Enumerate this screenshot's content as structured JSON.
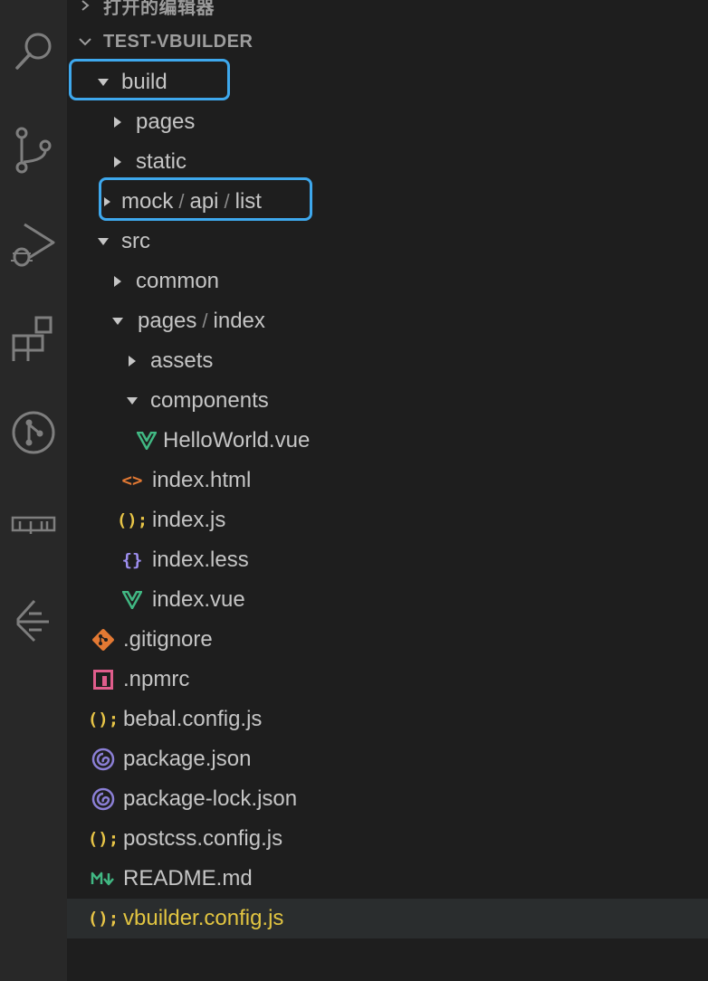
{
  "explorer": {
    "open_editors_label": "打开的编辑器",
    "project_label": "TEST-VBUILDER"
  },
  "tree": {
    "build": "build",
    "pages": "pages",
    "static": "static",
    "mock_parts": [
      "mock",
      "api",
      "list"
    ],
    "path_separator": "/",
    "src": "src",
    "common": "common",
    "pages_index_parts": [
      "pages",
      "index"
    ],
    "assets": "assets",
    "components": "components",
    "helloworld": "HelloWorld.vue",
    "index_html": "index.html",
    "index_js": "index.js",
    "index_less": "index.less",
    "index_vue": "index.vue",
    "gitignore": ".gitignore",
    "npmrc": ".npmrc",
    "bebal_config": "bebal.config.js",
    "package_json": "package.json",
    "package_lock": "package-lock.json",
    "postcss_config": "postcss.config.js",
    "readme": "README.md",
    "vbuilder_config": "vbuilder.config.js"
  },
  "icons": {
    "js_glyph": "();",
    "less_glyph": "{}",
    "html_glyph": "<>"
  },
  "colors": {
    "vue": "#41b883",
    "js": "#e8c547",
    "html": "#e37933",
    "less": "#9e8ff0",
    "git": "#e37933",
    "npm": "#e05d8c",
    "json": "#8b7fd6",
    "markdown": "#41b883",
    "highlight_box": "#3ea8ed",
    "selected_text": "#e2c541"
  }
}
